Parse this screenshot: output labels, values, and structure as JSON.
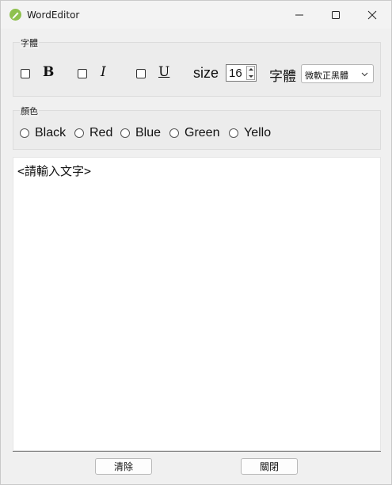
{
  "window": {
    "title": "WordEditor",
    "accent": "#4caf50"
  },
  "font_group": {
    "label": "字體",
    "bold_label": "B",
    "italic_label": "I",
    "underline_label": "U",
    "size_label": "size",
    "size_value": "16",
    "font_label": "字體",
    "font_value": "微軟正黑體"
  },
  "color_group": {
    "label": "顏色",
    "options": [
      {
        "label": "Black"
      },
      {
        "label": "Red"
      },
      {
        "label": "Blue"
      },
      {
        "label": "Green"
      },
      {
        "label": "Yello"
      }
    ]
  },
  "editor": {
    "text": "<請輸入文字>"
  },
  "buttons": {
    "clear": "清除",
    "close": "關閉"
  }
}
